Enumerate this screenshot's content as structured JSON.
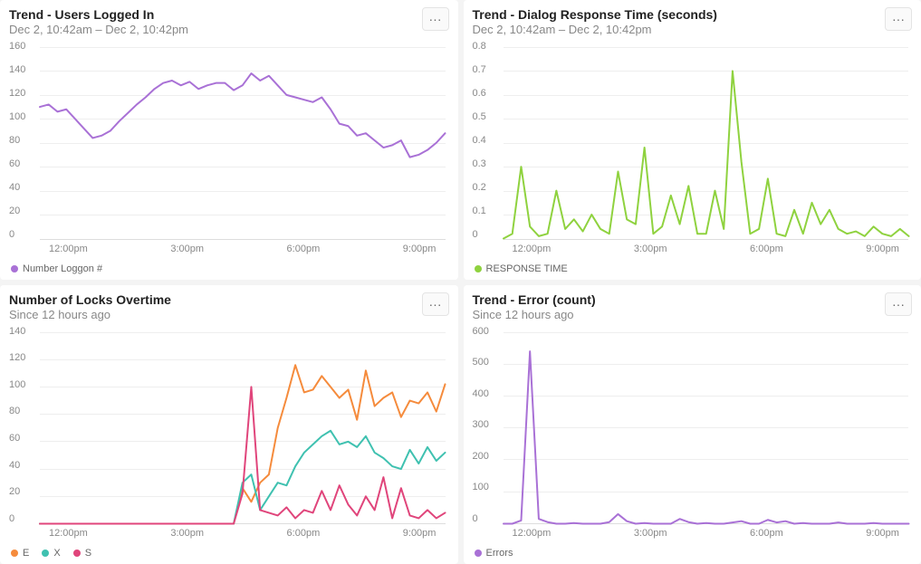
{
  "panels": [
    {
      "id": "users",
      "title": "Trend - Users Logged In",
      "subtitle": "Dec 2, 10:42am – Dec 2, 10:42pm",
      "legend": [
        {
          "label": "Number Loggon #",
          "color": "#a971d6"
        }
      ],
      "y_ticks": [
        "160",
        "140",
        "120",
        "100",
        "80",
        "60",
        "40",
        "20",
        "0"
      ],
      "x_ticks": [
        "12:00pm",
        "3:00pm",
        "6:00pm",
        "9:00pm"
      ]
    },
    {
      "id": "response",
      "title": "Trend - Dialog Response Time (seconds)",
      "subtitle": "Dec 2, 10:42am – Dec 2, 10:42pm",
      "legend": [
        {
          "label": "RESPONSE TIME",
          "color": "#8fd23f"
        }
      ],
      "y_ticks": [
        "0.8",
        "0.7",
        "0.6",
        "0.5",
        "0.4",
        "0.3",
        "0.2",
        "0.1",
        "0"
      ],
      "x_ticks": [
        "12:00pm",
        "3:00pm",
        "6:00pm",
        "9:00pm"
      ]
    },
    {
      "id": "locks",
      "title": "Number of Locks Overtime",
      "subtitle": "Since 12 hours ago",
      "legend": [
        {
          "label": "E",
          "color": "#f58b3c"
        },
        {
          "label": "X",
          "color": "#3fc1b0"
        },
        {
          "label": "S",
          "color": "#e0457b"
        }
      ],
      "y_ticks": [
        "140",
        "120",
        "100",
        "80",
        "60",
        "40",
        "20",
        "0"
      ],
      "x_ticks": [
        "12:00pm",
        "3:00pm",
        "6:00pm",
        "9:00pm"
      ]
    },
    {
      "id": "errors",
      "title": "Trend - Error (count)",
      "subtitle": "Since 12 hours ago",
      "legend": [
        {
          "label": "Errors",
          "color": "#a971d6"
        }
      ],
      "y_ticks": [
        "600",
        "500",
        "400",
        "300",
        "200",
        "100",
        "0"
      ],
      "x_ticks": [
        "12:00pm",
        "3:00pm",
        "6:00pm",
        "9:00pm"
      ]
    }
  ],
  "chart_data": [
    {
      "type": "line",
      "title": "Trend - Users Logged In",
      "xlabel": "",
      "ylabel": "",
      "ylim": [
        0,
        160
      ],
      "x_ticks": [
        "12:00pm",
        "3:00pm",
        "6:00pm",
        "9:00pm"
      ],
      "x_range": [
        "10:42am",
        "10:42pm"
      ],
      "series": [
        {
          "name": "Number Loggon #",
          "color": "#a971d6",
          "values": [
            110,
            112,
            106,
            108,
            100,
            92,
            84,
            86,
            90,
            98,
            105,
            112,
            118,
            125,
            130,
            132,
            128,
            131,
            125,
            128,
            130,
            130,
            124,
            128,
            138,
            132,
            136,
            128,
            120,
            118,
            116,
            114,
            118,
            108,
            96,
            94,
            86,
            88,
            82,
            76,
            78,
            82,
            68,
            70,
            74,
            80,
            88
          ]
        }
      ]
    },
    {
      "type": "line",
      "title": "Trend - Dialog Response Time (seconds)",
      "xlabel": "",
      "ylabel": "",
      "ylim": [
        0,
        0.8
      ],
      "x_ticks": [
        "12:00pm",
        "3:00pm",
        "6:00pm",
        "9:00pm"
      ],
      "x_range": [
        "10:42am",
        "10:42pm"
      ],
      "series": [
        {
          "name": "RESPONSE TIME",
          "color": "#8fd23f",
          "values": [
            0,
            0.02,
            0.3,
            0.05,
            0.01,
            0.02,
            0.2,
            0.04,
            0.08,
            0.03,
            0.1,
            0.04,
            0.02,
            0.28,
            0.08,
            0.06,
            0.38,
            0.02,
            0.05,
            0.18,
            0.06,
            0.22,
            0.02,
            0.02,
            0.2,
            0.04,
            0.7,
            0.32,
            0.02,
            0.04,
            0.25,
            0.02,
            0.01,
            0.12,
            0.02,
            0.15,
            0.06,
            0.12,
            0.04,
            0.02,
            0.03,
            0.01,
            0.05,
            0.02,
            0.01,
            0.04,
            0.01
          ]
        }
      ]
    },
    {
      "type": "line",
      "title": "Number of Locks Overtime",
      "xlabel": "",
      "ylabel": "",
      "ylim": [
        0,
        140
      ],
      "x_ticks": [
        "12:00pm",
        "3:00pm",
        "6:00pm",
        "9:00pm"
      ],
      "x_range": [
        "Since 12 hours ago",
        ""
      ],
      "series": [
        {
          "name": "E",
          "color": "#f58b3c",
          "values": [
            0,
            0,
            0,
            0,
            0,
            0,
            0,
            0,
            0,
            0,
            0,
            0,
            0,
            0,
            0,
            0,
            0,
            0,
            0,
            0,
            0,
            0,
            0,
            26,
            16,
            30,
            36,
            70,
            92,
            116,
            96,
            98,
            108,
            100,
            92,
            98,
            76,
            112,
            86,
            92,
            96,
            78,
            90,
            88,
            96,
            82,
            102
          ]
        },
        {
          "name": "X",
          "color": "#3fc1b0",
          "values": [
            0,
            0,
            0,
            0,
            0,
            0,
            0,
            0,
            0,
            0,
            0,
            0,
            0,
            0,
            0,
            0,
            0,
            0,
            0,
            0,
            0,
            0,
            0,
            30,
            36,
            10,
            20,
            30,
            28,
            42,
            52,
            58,
            64,
            68,
            58,
            60,
            56,
            64,
            52,
            48,
            42,
            40,
            54,
            44,
            56,
            46,
            52
          ]
        },
        {
          "name": "S",
          "color": "#e0457b",
          "values": [
            0,
            0,
            0,
            0,
            0,
            0,
            0,
            0,
            0,
            0,
            0,
            0,
            0,
            0,
            0,
            0,
            0,
            0,
            0,
            0,
            0,
            0,
            0,
            22,
            100,
            10,
            8,
            6,
            12,
            4,
            10,
            8,
            24,
            10,
            28,
            14,
            6,
            20,
            10,
            34,
            4,
            26,
            6,
            4,
            10,
            4,
            8
          ]
        }
      ]
    },
    {
      "type": "line",
      "title": "Trend - Error (count)",
      "xlabel": "",
      "ylabel": "",
      "ylim": [
        0,
        600
      ],
      "x_ticks": [
        "12:00pm",
        "3:00pm",
        "6:00pm",
        "9:00pm"
      ],
      "x_range": [
        "Since 12 hours ago",
        ""
      ],
      "series": [
        {
          "name": "Errors",
          "color": "#a971d6",
          "values": [
            0,
            0,
            10,
            540,
            15,
            5,
            0,
            0,
            2,
            0,
            0,
            0,
            5,
            30,
            8,
            0,
            2,
            0,
            0,
            0,
            15,
            5,
            0,
            2,
            0,
            0,
            4,
            8,
            0,
            0,
            12,
            4,
            8,
            0,
            2,
            0,
            0,
            0,
            4,
            0,
            0,
            0,
            2,
            0,
            0,
            0,
            0
          ]
        }
      ]
    }
  ]
}
